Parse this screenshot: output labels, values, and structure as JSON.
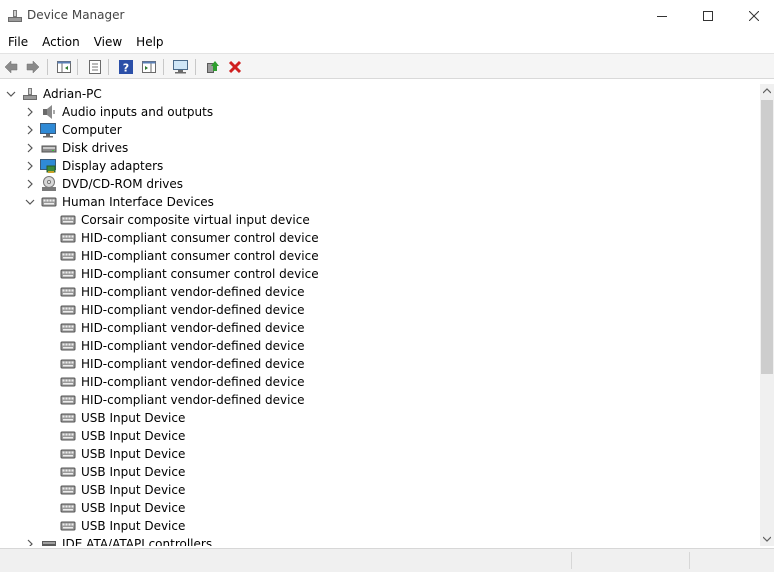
{
  "window": {
    "title": "Device Manager"
  },
  "menu": [
    "File",
    "Action",
    "View",
    "Help"
  ],
  "toolbar": {
    "buttons": [
      "back-icon",
      "forward-icon",
      "show-hide-console-tree-icon",
      "properties-icon",
      "help-icon",
      "show-action-pane-icon",
      "scan-hardware-icon",
      "update-driver-icon",
      "uninstall-device-icon"
    ]
  },
  "tree": {
    "root": "Adrian-PC",
    "categories": [
      {
        "label": "Audio inputs and outputs",
        "icon": "speaker-icon",
        "expanded": false
      },
      {
        "label": "Computer",
        "icon": "monitor-icon",
        "expanded": false
      },
      {
        "label": "Disk drives",
        "icon": "disk-drive-icon",
        "expanded": false
      },
      {
        "label": "Display adapters",
        "icon": "display-adapter-icon",
        "expanded": false
      },
      {
        "label": "DVD/CD-ROM drives",
        "icon": "optical-drive-icon",
        "expanded": false
      },
      {
        "label": "Human Interface Devices",
        "icon": "hid-icon",
        "expanded": true
      }
    ],
    "hid_devices": [
      "Corsair composite virtual input device",
      "HID-compliant consumer control device",
      "HID-compliant consumer control device",
      "HID-compliant consumer control device",
      "HID-compliant vendor-defined device",
      "HID-compliant vendor-defined device",
      "HID-compliant vendor-defined device",
      "HID-compliant vendor-defined device",
      "HID-compliant vendor-defined device",
      "HID-compliant vendor-defined device",
      "HID-compliant vendor-defined device",
      "USB Input Device",
      "USB Input Device",
      "USB Input Device",
      "USB Input Device",
      "USB Input Device",
      "USB Input Device",
      "USB Input Device"
    ],
    "after": [
      {
        "label": "IDE ATA/ATAPI controllers",
        "icon": "ide-controller-icon",
        "expanded": false
      }
    ]
  },
  "colors": {
    "accent": "#0078d7",
    "close_red": "#d01f1f",
    "help_blue": "#2b4fa8"
  }
}
